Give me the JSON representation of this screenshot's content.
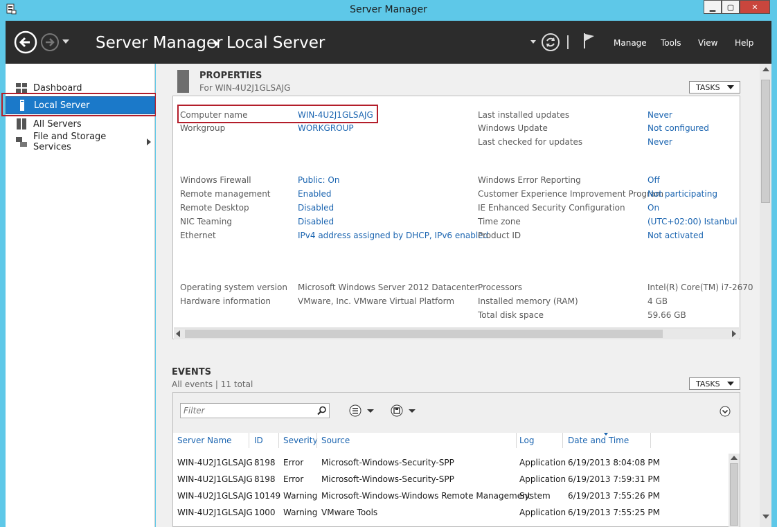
{
  "window": {
    "title": "Server Manager"
  },
  "header": {
    "breadcrumb": [
      "Server Manager",
      "Local Server"
    ],
    "menu": [
      "Manage",
      "Tools",
      "View",
      "Help"
    ]
  },
  "sidebar": {
    "items": [
      {
        "label": "Dashboard",
        "icon": "dashboard-icon"
      },
      {
        "label": "Local Server",
        "icon": "server-icon",
        "selected": true
      },
      {
        "label": "All Servers",
        "icon": "servers-icon"
      },
      {
        "label": "File and Storage Services",
        "icon": "storage-icon",
        "has_submenu": true
      }
    ]
  },
  "properties": {
    "title": "PROPERTIES",
    "subtitle": "For WIN-4U2J1GLSAJG",
    "tasks_label": "TASKS",
    "left": [
      {
        "label": "Computer name",
        "value": "WIN-4U2J1GLSAJG"
      },
      {
        "label": "Workgroup",
        "value": "WORKGROUP"
      },
      {
        "label": "Windows Firewall",
        "value": "Public: On"
      },
      {
        "label": "Remote management",
        "value": "Enabled"
      },
      {
        "label": "Remote Desktop",
        "value": "Disabled"
      },
      {
        "label": "NIC Teaming",
        "value": "Disabled"
      },
      {
        "label": "Ethernet",
        "value": "IPv4 address assigned by DHCP, IPv6 enabled"
      },
      {
        "label": "Operating system version",
        "value": "Microsoft Windows Server 2012 Datacenter"
      },
      {
        "label": "Hardware information",
        "value": "VMware, Inc. VMware Virtual Platform"
      }
    ],
    "right": [
      {
        "label": "Last installed updates",
        "value": "Never"
      },
      {
        "label": "Windows Update",
        "value": "Not configured"
      },
      {
        "label": "Last checked for updates",
        "value": "Never"
      },
      {
        "label": "Windows Error Reporting",
        "value": "Off"
      },
      {
        "label": "Customer Experience Improvement Program",
        "value": "Not participating"
      },
      {
        "label": "IE Enhanced Security Configuration",
        "value": "On"
      },
      {
        "label": "Time zone",
        "value": "(UTC+02:00) Istanbul"
      },
      {
        "label": "Product ID",
        "value": "Not activated"
      },
      {
        "label": "Processors",
        "value": "Intel(R) Core(TM) i7-2670"
      },
      {
        "label": "Installed memory (RAM)",
        "value": "4 GB"
      },
      {
        "label": "Total disk space",
        "value": "59.66 GB"
      }
    ]
  },
  "events": {
    "title": "EVENTS",
    "summary": "All events | 11 total",
    "tasks_label": "TASKS",
    "filter_placeholder": "Filter",
    "columns": [
      "Server Name",
      "ID",
      "Severity",
      "Source",
      "Log",
      "Date and Time"
    ],
    "rows": [
      [
        "WIN-4U2J1GLSAJG",
        "8198",
        "Error",
        "Microsoft-Windows-Security-SPP",
        "Application",
        "6/19/2013 8:04:08 PM"
      ],
      [
        "WIN-4U2J1GLSAJG",
        "8198",
        "Error",
        "Microsoft-Windows-Security-SPP",
        "Application",
        "6/19/2013 7:59:31 PM"
      ],
      [
        "WIN-4U2J1GLSAJG",
        "10149",
        "Warning",
        "Microsoft-Windows-Windows Remote Management",
        "System",
        "6/19/2013 7:55:26 PM"
      ],
      [
        "WIN-4U2J1GLSAJG",
        "1000",
        "Warning",
        "VMware Tools",
        "Application",
        "6/19/2013 7:55:25 PM"
      ]
    ]
  },
  "colors": {
    "accent": "#1b79c9",
    "link": "#1a64b0",
    "header_bg": "#2c2c2c",
    "frame": "#5ec8e8",
    "highlight": "#b31d2a"
  }
}
